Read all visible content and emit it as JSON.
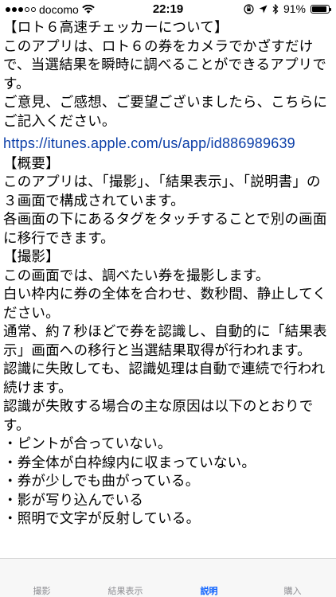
{
  "status_bar": {
    "carrier": "docomo",
    "time": "22:19",
    "battery": "91%",
    "battery_level": 0.91
  },
  "content": {
    "paragraphs": [
      "【ロト６高速チェッカーについて】",
      "このアプリは、ロト６の券をカメラでかざすだけで、当選結果を瞬時に調べることができるアプリです。",
      "",
      "ご意見、ご感想、ご要望ございましたら、こちらにご記入ください。",
      "https://itunes.apple.com/us/app/id886989639",
      "【概要】",
      "このアプリは、「撮影」、「結果表示」、「説明書」の３画面で構成されています。",
      "各画面の下にあるタグをタッチすることで別の画面に移行できます。",
      "",
      "【撮影】",
      "この画面では、調べたい券を撮影します。",
      "白い枠内に券の全体を合わせ、数秒間、静止してください。",
      "通常、約７秒ほどで券を認識し、自動的に「結果表示」画面への移行と当選結果取得が行われます。",
      "認識に失敗しても、認識処理は自動で連続で行われ続けます。",
      "認識が失敗する場合の主な原因は以下のとおりです。",
      "・ピントが合っていない。",
      "・券全体が白枠線内に収まっていない。",
      "・券が少しでも曲がっている。",
      "・影が写り込んでいる",
      "・照明で文字が反射している。"
    ]
  },
  "tabs": [
    {
      "label": "撮影",
      "active": false
    },
    {
      "label": "結果表示",
      "active": false
    },
    {
      "label": "説明",
      "active": true
    },
    {
      "label": "購入",
      "active": false
    }
  ],
  "colors": {
    "link": "#0b3ea8",
    "tab_active": "#0a60ff",
    "tab_inactive": "#8e8e93"
  }
}
